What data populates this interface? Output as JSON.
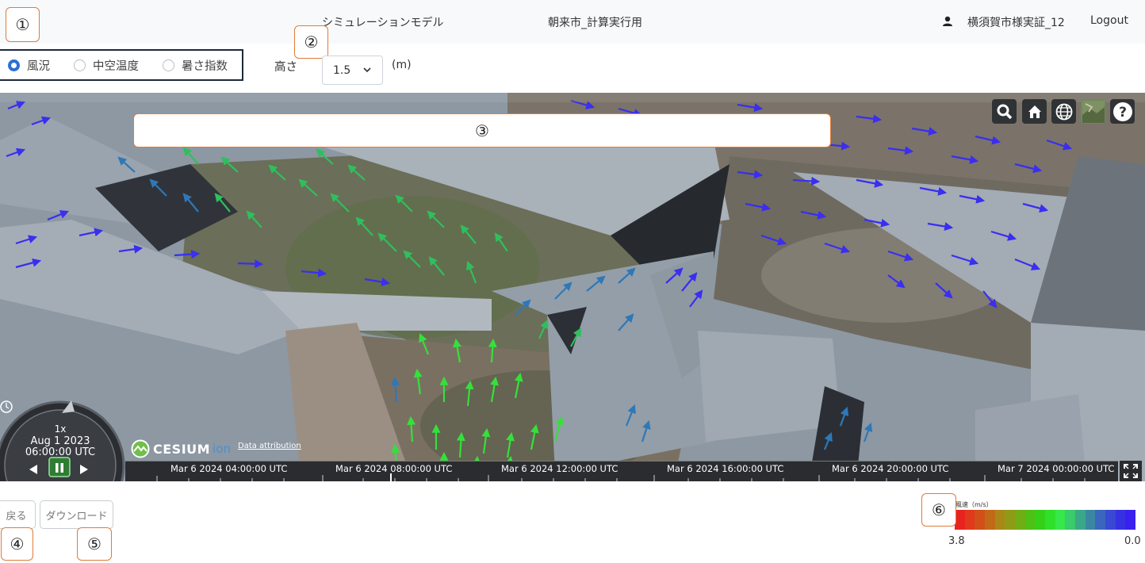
{
  "header": {
    "model": "シミュレーションモデル",
    "project": "朝来市_計算実行用",
    "user_icon": "person-icon",
    "user_name": "横須賀市様実証_12",
    "logout": "Logout"
  },
  "callouts": [
    "①",
    "②",
    "③",
    "④",
    "⑤",
    "⑥"
  ],
  "toolbar": {
    "modes": [
      {
        "label": "風況",
        "checked": true
      },
      {
        "label": "中空温度",
        "checked": false
      },
      {
        "label": "暑さ指数",
        "checked": false
      }
    ],
    "height_label": "高さ",
    "height_value": "1.5",
    "height_unit": "(m)"
  },
  "viewer": {
    "toolbar_icons": [
      "search-icon",
      "home-icon",
      "globe-icon",
      "imagery-layer-icon",
      "help-icon"
    ],
    "clock": {
      "speed": "1x",
      "date": "Aug 1 2023",
      "time": "06:00:00 UTC"
    },
    "logo": {
      "word": "CESIUM",
      "suffix": "ion"
    },
    "attribution": "Data attribution",
    "timeline_ticks": [
      "Mar 6 2024 04:00:00 UTC",
      "Mar 6 2024 08:00:00 UTC",
      "Mar 6 2024 12:00:00 UTC",
      "Mar 6 2024 16:00:00 UTC",
      "Mar 6 2024 20:00:00 UTC",
      "Mar 7 2024 00:00:00 UTC"
    ]
  },
  "buttons": {
    "back": "戻る",
    "download": "ダウンロード"
  },
  "legend": {
    "title": "風速（m/s）",
    "min": "3.8",
    "max": "0.0",
    "colors": [
      "#e8231f",
      "#e0391c",
      "#d24f1a",
      "#c06a18",
      "#a98817",
      "#8f9b16",
      "#6fae15",
      "#4fc015",
      "#35d018",
      "#2ee02a",
      "#36e84a",
      "#3acb6a",
      "#3aa888",
      "#3b86a3",
      "#3a66bd",
      "#3849d4",
      "#3630e3",
      "#3a1ff0"
    ]
  }
}
